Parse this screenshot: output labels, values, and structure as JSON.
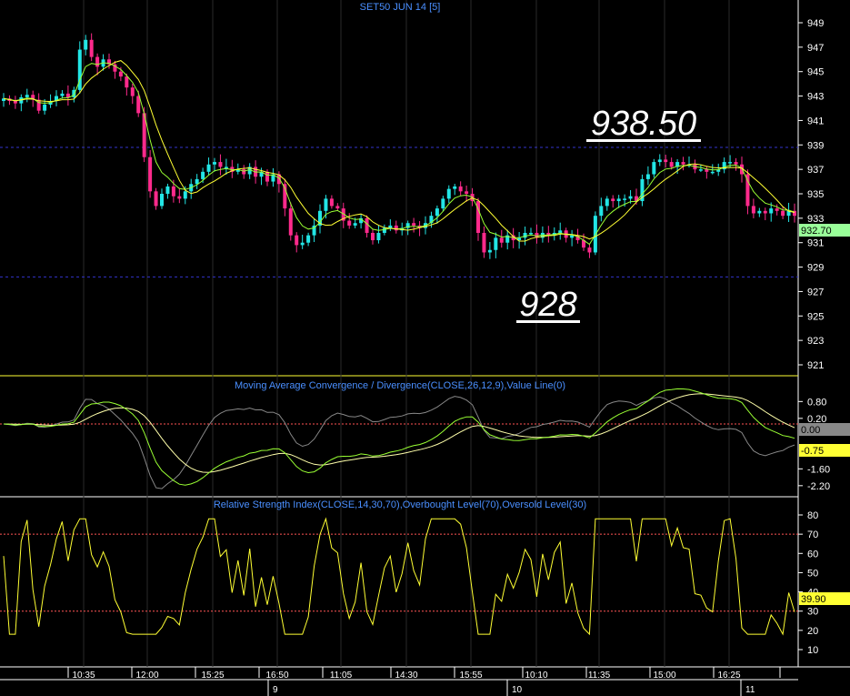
{
  "chart_data": [
    {
      "type": "candlestick",
      "title": "SET50 JUN 14  [5]",
      "y_ticks": [
        "949",
        "947",
        "945",
        "943",
        "941",
        "939",
        "937",
        "935",
        "933",
        "931",
        "929",
        "927",
        "925",
        "923",
        "921"
      ],
      "ylim": [
        920,
        950
      ],
      "last_price": "932.70",
      "reference_lines": [
        938.8,
        928.2
      ],
      "annotations": {
        "high": "938.50",
        "low": "928"
      },
      "x_ticks": [
        "10:35",
        "12:00",
        "15:25",
        "16:50",
        "11:05",
        "14:30",
        "15:55",
        "10:10",
        "11:35",
        "15:00",
        "16:25"
      ],
      "date_labels": [
        "9",
        "10",
        "11"
      ],
      "closes": [
        942.8,
        942.6,
        942.4,
        942.9,
        943.1,
        942.7,
        941.8,
        942.3,
        942.6,
        943.0,
        943.2,
        942.9,
        943.5,
        946.8,
        947.6,
        946.2,
        945.4,
        946.0,
        945.6,
        945.0,
        944.6,
        943.7,
        943.0,
        941.6,
        938.0,
        935.2,
        934.0,
        935.0,
        935.6,
        934.8,
        934.6,
        935.2,
        935.8,
        936.2,
        936.8,
        937.4,
        937.6,
        937.2,
        937.2,
        936.8,
        937.0,
        936.6,
        937.2,
        936.4,
        936.8,
        936.0,
        936.6,
        935.8,
        933.8,
        931.6,
        930.8,
        931.0,
        931.6,
        932.4,
        933.6,
        934.6,
        934.0,
        933.8,
        932.8,
        932.4,
        932.6,
        933.0,
        931.8,
        931.2,
        931.8,
        932.2,
        932.4,
        932.0,
        932.2,
        932.6,
        932.4,
        932.2,
        932.6,
        933.2,
        933.8,
        934.6,
        935.4,
        935.6,
        935.2,
        935.0,
        934.4,
        931.8,
        930.2,
        930.4,
        931.4,
        931.0,
        931.6,
        931.2,
        931.4,
        931.8,
        931.8,
        931.4,
        931.8,
        931.6,
        931.8,
        932.0,
        931.4,
        931.6,
        931.2,
        930.6,
        930.2,
        933.2,
        934.0,
        934.6,
        934.4,
        934.6,
        934.6,
        934.8,
        934.4,
        936.2,
        936.6,
        937.6,
        937.8,
        937.6,
        937.2,
        937.6,
        937.4,
        937.4,
        937.0,
        937.0,
        936.8,
        936.8,
        937.0,
        937.6,
        937.6,
        937.4,
        936.6,
        934.0,
        933.4,
        933.6,
        933.4,
        933.8,
        933.6,
        933.2,
        933.6,
        933.2
      ],
      "macd": {
        "title": "Moving Average Convergence / Divergence(CLOSE,26,12,9),Value Line(0)",
        "y_ticks": [
          "0.80",
          "0.20",
          "-1.60",
          "-2.20"
        ],
        "ylim": [
          -2.6,
          1.2
        ],
        "current": "-0.75",
        "zero_label": "0.00"
      },
      "rsi": {
        "title": "Relative Strength Index(CLOSE,14,30,70),Overbought Level(70),Oversold Level(30)",
        "y_ticks": [
          "80",
          "70",
          "60",
          "50",
          "40",
          "30",
          "20",
          "10"
        ],
        "ylim": [
          0,
          88
        ],
        "levels": [
          70,
          30
        ],
        "current": "39.90"
      }
    }
  ],
  "colors": {
    "up": "#22e6e6",
    "down": "#ff2a8c",
    "sma": "#ffff33",
    "ema": "#99ff33",
    "signal": "#ffffaa",
    "grid": "#2a2a2a",
    "label": "#4a8fff",
    "ref": "#3333cc"
  }
}
